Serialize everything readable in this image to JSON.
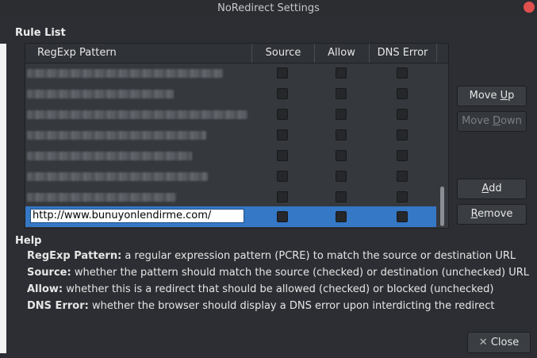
{
  "window": {
    "title": "NoRedirect Settings"
  },
  "rule_list": {
    "title": "Rule List",
    "columns": [
      "RegExp Pattern",
      "Source",
      "Allow",
      "DNS Error"
    ],
    "edit_value": "http://www.bunuyonlendirme.com/"
  },
  "buttons": {
    "move_up": [
      "Move ",
      "U",
      "p"
    ],
    "move_down": [
      "Move ",
      "D",
      "own"
    ],
    "add": [
      "",
      "A",
      "dd"
    ],
    "remove": [
      "",
      "R",
      "emove"
    ],
    "close": "Close",
    "close_icon": "✕"
  },
  "help": {
    "title": "Help",
    "lines": [
      {
        "term": "RegExp Pattern:",
        "text": " a regular expression pattern (PCRE) to match the source or destination URL"
      },
      {
        "term": "Source:",
        "text": " whether the pattern should match the source (checked) or destination (unchecked) URL"
      },
      {
        "term": "Allow:",
        "text": " whether this is a redirect that should be allowed (checked) or blocked (unchecked)"
      },
      {
        "term": "DNS Error:",
        "text": " whether the browser should display a DNS error upon interdicting the redirect"
      }
    ]
  }
}
